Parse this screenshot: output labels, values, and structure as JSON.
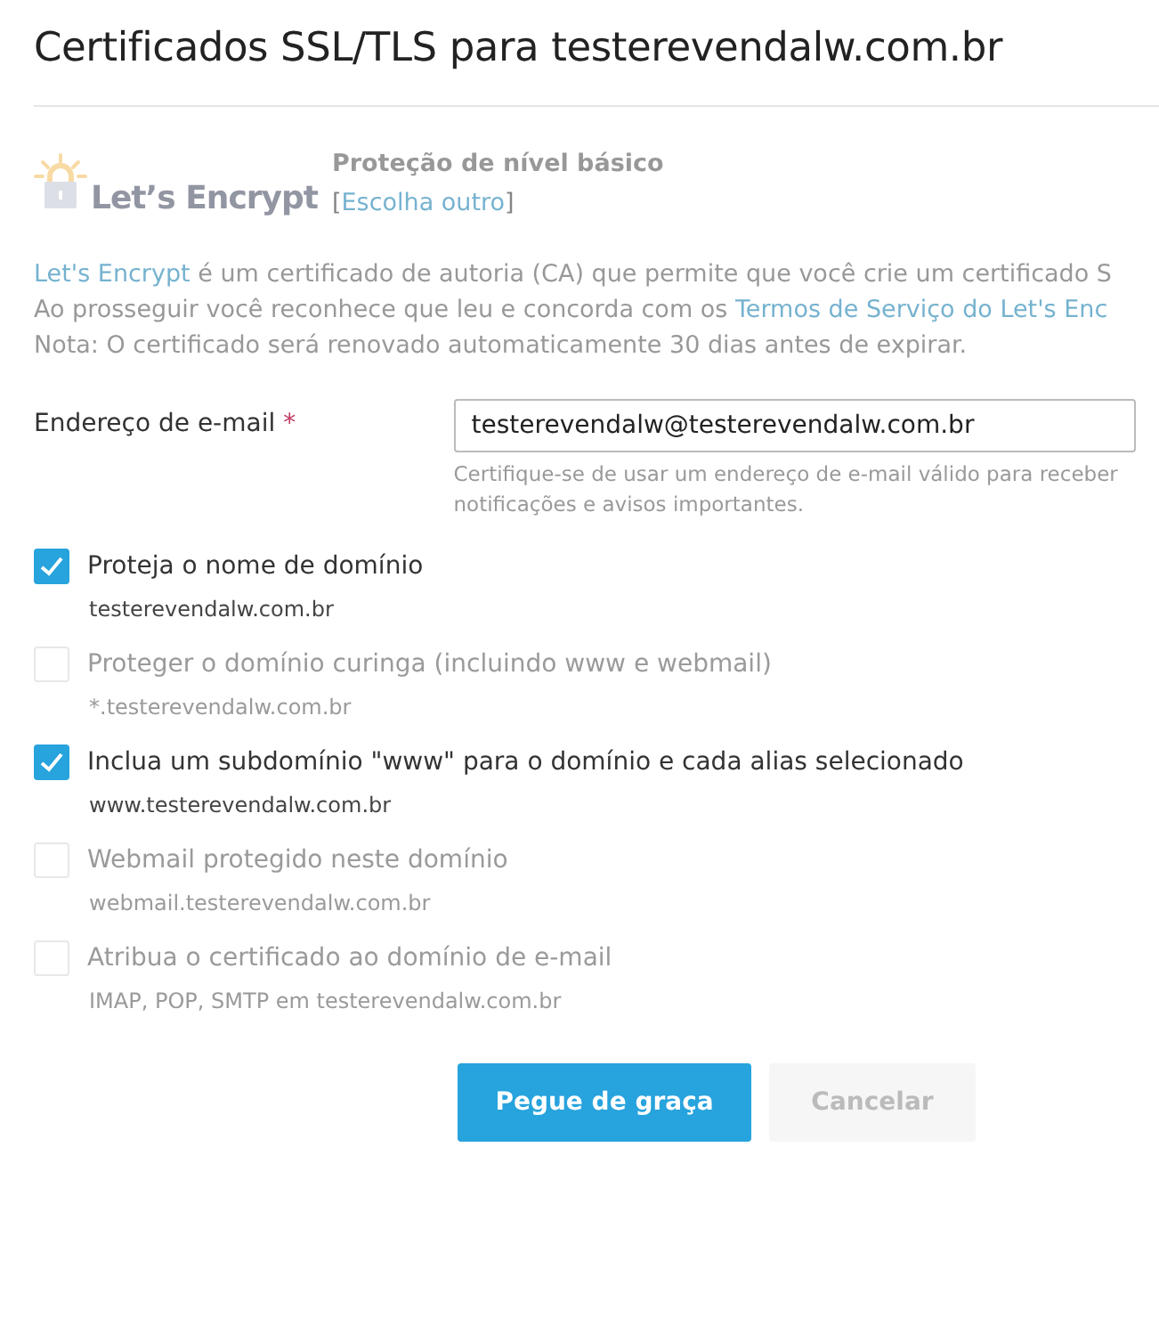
{
  "title": "Certificados SSL/TLS para testerevendalw.com.br",
  "provider": {
    "logo_text": "Let’s Encrypt",
    "heading": "Proteção de nível básico",
    "bracket_open": "[",
    "change_link": "Escolha outro",
    "bracket_close": "]",
    "disabled": true
  },
  "description": [
    {
      "parts": [
        {
          "kind": "link",
          "text": "Let's Encrypt"
        },
        {
          "kind": "text",
          "text": " é um certificado de autoria (CA) que permite que você crie um certificado S"
        }
      ]
    },
    {
      "parts": [
        {
          "kind": "text",
          "text": "Ao prosseguir você reconhece que leu e concorda com os "
        },
        {
          "kind": "link",
          "text": "Termos de Serviço do Let's Enc"
        }
      ]
    },
    {
      "parts": [
        {
          "kind": "text",
          "text": "Nota: O certificado será renovado automaticamente 30 dias antes de expirar."
        }
      ]
    }
  ],
  "email": {
    "label": "Endereço de e-mail",
    "required_mark": "*",
    "value": "testerevendalw@testerevendalw.com.br",
    "hint": "Certifique-se de usar um endereço de e-mail válido para receber notificações e avisos importantes."
  },
  "options": [
    {
      "label": "Proteja o nome de domínio",
      "detail": "testerevendalw.com.br",
      "checked": true,
      "disabled": false
    },
    {
      "label": "Proteger o domínio curinga (incluindo www e webmail)",
      "detail": "*.testerevendalw.com.br",
      "checked": false,
      "disabled": true
    },
    {
      "label": "Inclua um subdomínio \"www\" para o domínio e cada alias selecionado",
      "detail": "www.testerevendalw.com.br",
      "checked": true,
      "disabled": false
    },
    {
      "label": "Webmail protegido neste domínio",
      "detail": "webmail.testerevendalw.com.br",
      "checked": false,
      "disabled": true
    },
    {
      "label": "Atribua o certificado ao domínio de e-mail",
      "detail": "IMAP, POP, SMTP em testerevendalw.com.br",
      "checked": false,
      "disabled": true
    }
  ],
  "buttons": [
    {
      "label": "Pegue de graça",
      "kind": "primary",
      "disabled": false
    },
    {
      "label": "Cancelar",
      "kind": "secondary",
      "disabled": true
    }
  ]
}
